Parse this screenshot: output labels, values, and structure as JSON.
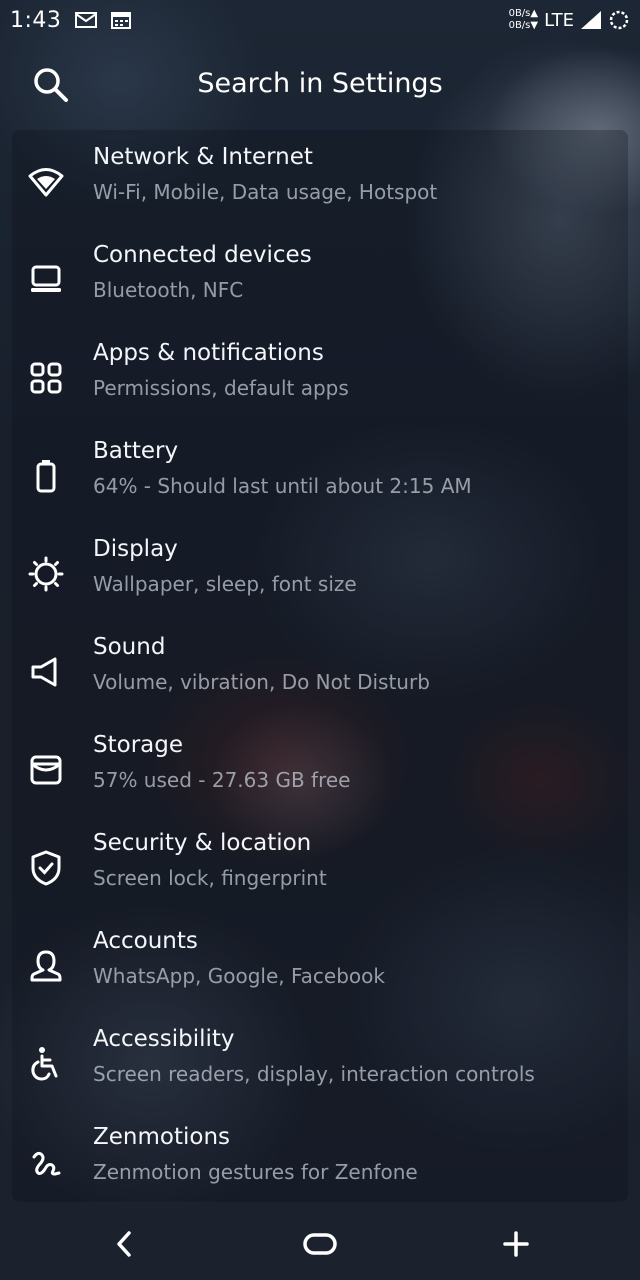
{
  "status_bar": {
    "time": "1:43",
    "net_up": "0B/s▲",
    "net_down": "0B/s▼",
    "network": "LTE",
    "icons": [
      "mail-icon",
      "calendar-icon",
      "signal-icon",
      "battery-saver-icon"
    ]
  },
  "header": {
    "title": "Search in Settings",
    "icon": "search-icon"
  },
  "settings": {
    "items": [
      {
        "title": "Network & Internet",
        "subtitle": "Wi-Fi, Mobile, Data usage, Hotspot",
        "icon": "wifi-icon"
      },
      {
        "title": "Connected devices",
        "subtitle": "Bluetooth, NFC",
        "icon": "devices-icon"
      },
      {
        "title": "Apps & notifications",
        "subtitle": "Permissions, default apps",
        "icon": "apps-icon"
      },
      {
        "title": "Battery",
        "subtitle": "64% - Should last until about 2:15 AM",
        "icon": "battery-icon"
      },
      {
        "title": "Display",
        "subtitle": "Wallpaper, sleep, font size",
        "icon": "brightness-icon"
      },
      {
        "title": "Sound",
        "subtitle": "Volume, vibration, Do Not Disturb",
        "icon": "speaker-icon"
      },
      {
        "title": "Storage",
        "subtitle": "57% used - 27.63 GB free",
        "icon": "storage-icon"
      },
      {
        "title": "Security & location",
        "subtitle": "Screen lock, fingerprint",
        "icon": "shield-icon"
      },
      {
        "title": "Accounts",
        "subtitle": "WhatsApp, Google, Facebook",
        "icon": "account-icon"
      },
      {
        "title": "Accessibility",
        "subtitle": "Screen readers, display, interaction controls",
        "icon": "accessibility-icon"
      },
      {
        "title": "Zenmotions",
        "subtitle": "Zenmotion gestures for Zenfone",
        "icon": "gesture-icon"
      }
    ]
  },
  "nav_bar": {
    "icons": [
      "back-icon",
      "home-icon",
      "add-icon"
    ]
  },
  "colors": {
    "text_primary": "#f4f6f9",
    "text_secondary": "#c8ced8",
    "background": "#1a1f29"
  }
}
